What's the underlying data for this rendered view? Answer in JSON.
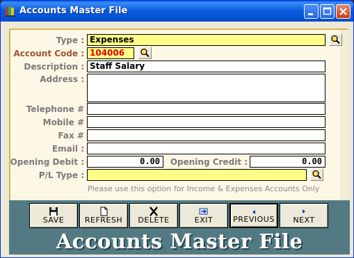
{
  "window": {
    "title": "Accounts Master File"
  },
  "form": {
    "type": {
      "label": "Type :",
      "value": "Expenses"
    },
    "account_code": {
      "label": "Account Code :",
      "value": "104006"
    },
    "description": {
      "label": "Description :",
      "value": "Staff Salary"
    },
    "address": {
      "label": "Address :",
      "value": ""
    },
    "telephone": {
      "label": "Telephone #",
      "value": ""
    },
    "mobile": {
      "label": "Mobile #",
      "value": ""
    },
    "fax": {
      "label": "Fax #",
      "value": ""
    },
    "email": {
      "label": "Email :",
      "value": ""
    },
    "opening_debit": {
      "label": "Opening Debit :",
      "value": "0.00"
    },
    "opening_credit": {
      "label": "Opening Credit :",
      "value": "0.00"
    },
    "pl_type": {
      "label": "P/L Type :",
      "value": ""
    },
    "hint": "Please use this option for Income & Expenses Accounts Only"
  },
  "toolbar": {
    "save": "SAVE",
    "refresh": "REFRESH",
    "delete": "DELETE",
    "exit": "EXIT",
    "previous": "PREVIOUS",
    "next": "NEXT"
  },
  "banner": "Accounts Master File",
  "colors": {
    "title_bar": "#0653d6",
    "form_bg": "#fdf8e6",
    "highlight_field": "#ffff88",
    "code_text": "#e00000",
    "toolbar_bg": "#537a82"
  }
}
